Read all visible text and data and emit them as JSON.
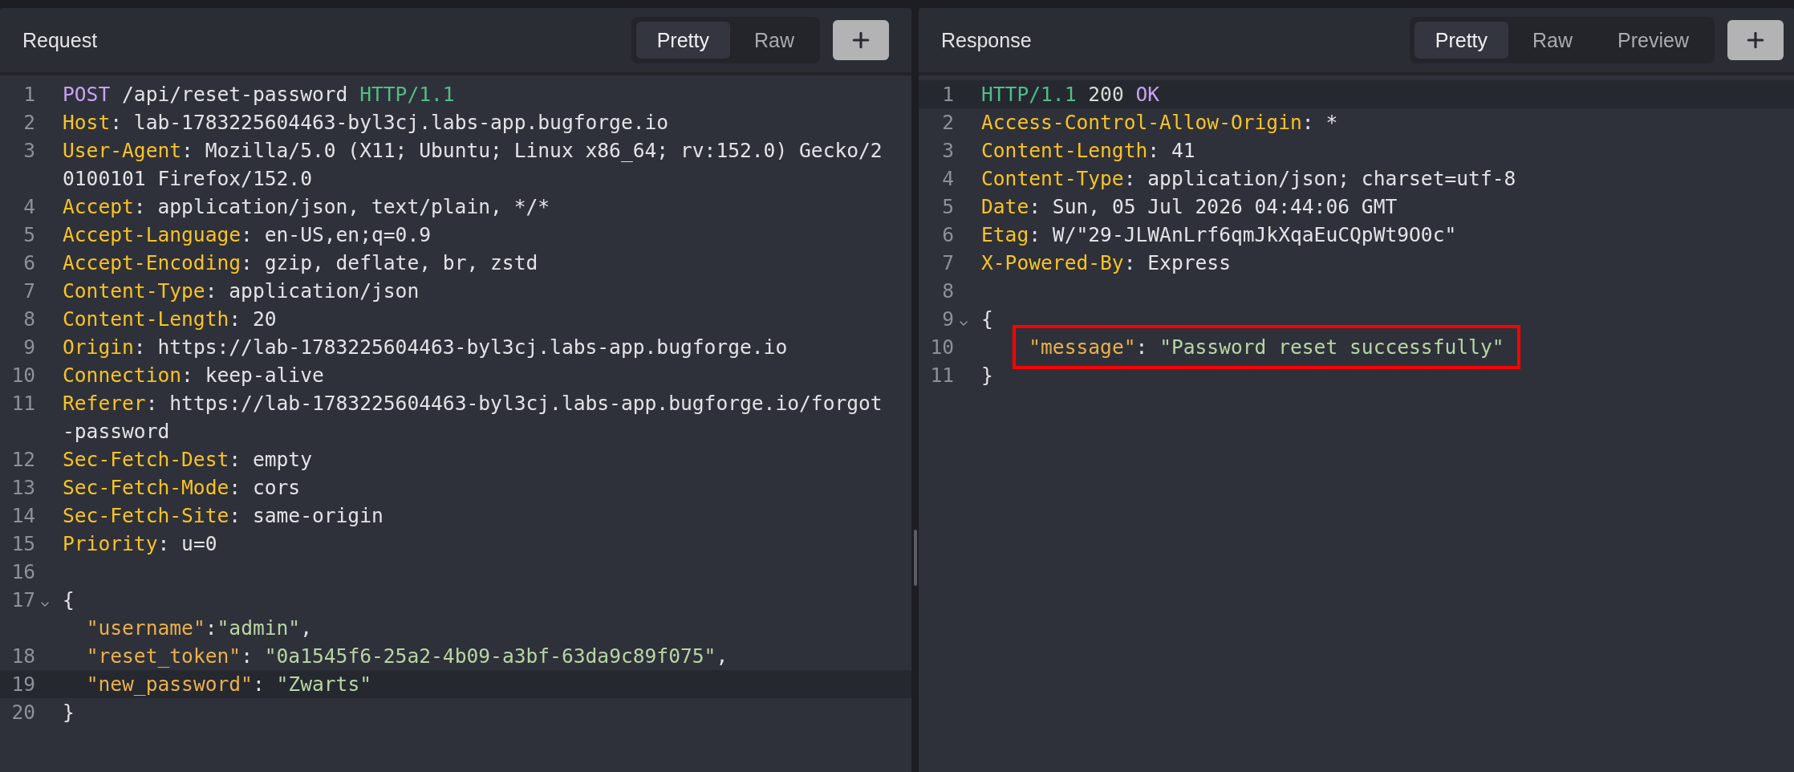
{
  "panels": [
    {
      "title": "Request",
      "tabs": [
        {
          "label": "Pretty",
          "selected": true
        },
        {
          "label": "Raw",
          "selected": false
        }
      ],
      "lines": [
        {
          "number": "1",
          "selected": false,
          "collapsible": false,
          "boxed": false,
          "rows": [
            [
              {
                "kind": "method",
                "text": "POST"
              },
              {
                "kind": "plain",
                "text": " /api/reset-password "
              },
              {
                "kind": "version",
                "text": "HTTP/1.1"
              }
            ]
          ]
        },
        {
          "number": "2",
          "selected": false,
          "collapsible": false,
          "boxed": false,
          "rows": [
            [
              {
                "kind": "key",
                "text": "Host"
              },
              {
                "kind": "plain",
                "text": ": lab-1783225604463-byl3cj.labs-app.bugforge.io"
              }
            ]
          ]
        },
        {
          "number": "3",
          "selected": false,
          "collapsible": false,
          "boxed": false,
          "rows": [
            [
              {
                "kind": "key",
                "text": "User-Agent"
              },
              {
                "kind": "plain",
                "text": ": Mozilla/5.0 (X11; Ubuntu; Linux x86_64; rv:152.0) Gecko/2"
              }
            ],
            [
              {
                "kind": "plain",
                "text": "0100101 Firefox/152.0"
              }
            ]
          ]
        },
        {
          "number": "4",
          "selected": false,
          "collapsible": false,
          "boxed": false,
          "rows": [
            [
              {
                "kind": "key",
                "text": "Accept"
              },
              {
                "kind": "plain",
                "text": ": application/json, text/plain, */*"
              }
            ]
          ]
        },
        {
          "number": "5",
          "selected": false,
          "collapsible": false,
          "boxed": false,
          "rows": [
            [
              {
                "kind": "key",
                "text": "Accept-Language"
              },
              {
                "kind": "plain",
                "text": ": en-US,en;q=0.9"
              }
            ]
          ]
        },
        {
          "number": "6",
          "selected": false,
          "collapsible": false,
          "boxed": false,
          "rows": [
            [
              {
                "kind": "key",
                "text": "Accept-Encoding"
              },
              {
                "kind": "plain",
                "text": ": gzip, deflate, br, zstd"
              }
            ]
          ]
        },
        {
          "number": "7",
          "selected": false,
          "collapsible": false,
          "boxed": false,
          "rows": [
            [
              {
                "kind": "key",
                "text": "Content-Type"
              },
              {
                "kind": "plain",
                "text": ": application/json"
              }
            ]
          ]
        },
        {
          "number": "8",
          "selected": false,
          "collapsible": false,
          "boxed": false,
          "rows": [
            [
              {
                "kind": "key",
                "text": "Content-Length"
              },
              {
                "kind": "plain",
                "text": ": 20"
              }
            ]
          ]
        },
        {
          "number": "9",
          "selected": false,
          "collapsible": false,
          "boxed": false,
          "rows": [
            [
              {
                "kind": "key",
                "text": "Origin"
              },
              {
                "kind": "plain",
                "text": ": https://lab-1783225604463-byl3cj.labs-app.bugforge.io"
              }
            ]
          ]
        },
        {
          "number": "10",
          "selected": false,
          "collapsible": false,
          "boxed": false,
          "rows": [
            [
              {
                "kind": "key",
                "text": "Connection"
              },
              {
                "kind": "plain",
                "text": ": keep-alive"
              }
            ]
          ]
        },
        {
          "number": "11",
          "selected": false,
          "collapsible": false,
          "boxed": false,
          "rows": [
            [
              {
                "kind": "key",
                "text": "Referer"
              },
              {
                "kind": "plain",
                "text": ": https://lab-1783225604463-byl3cj.labs-app.bugforge.io/forgot"
              }
            ],
            [
              {
                "kind": "plain",
                "text": "-password"
              }
            ]
          ]
        },
        {
          "number": "12",
          "selected": false,
          "collapsible": false,
          "boxed": false,
          "rows": [
            [
              {
                "kind": "key",
                "text": "Sec-Fetch-Dest"
              },
              {
                "kind": "plain",
                "text": ": empty"
              }
            ]
          ]
        },
        {
          "number": "13",
          "selected": false,
          "collapsible": false,
          "boxed": false,
          "rows": [
            [
              {
                "kind": "key",
                "text": "Sec-Fetch-Mode"
              },
              {
                "kind": "plain",
                "text": ": cors"
              }
            ]
          ]
        },
        {
          "number": "14",
          "selected": false,
          "collapsible": false,
          "boxed": false,
          "rows": [
            [
              {
                "kind": "key",
                "text": "Sec-Fetch-Site"
              },
              {
                "kind": "plain",
                "text": ": same-origin"
              }
            ]
          ]
        },
        {
          "number": "15",
          "selected": false,
          "collapsible": false,
          "boxed": false,
          "rows": [
            [
              {
                "kind": "key",
                "text": "Priority"
              },
              {
                "kind": "plain",
                "text": ": u=0"
              }
            ]
          ]
        },
        {
          "number": "16",
          "selected": false,
          "collapsible": false,
          "boxed": false
        },
        {
          "number": "17",
          "selected": false,
          "collapsible": true,
          "boxed": false,
          "rows": [
            [
              {
                "kind": "plain",
                "text": "{"
              }
            ],
            [
              {
                "kind": "indent",
                "text": "  "
              },
              {
                "kind": "jkey",
                "text": "\"username\""
              },
              {
                "kind": "plain",
                "text": ":"
              },
              {
                "kind": "string",
                "text": "\"admin\""
              },
              {
                "kind": "plain",
                "text": ","
              }
            ]
          ]
        },
        {
          "number": "18",
          "selected": false,
          "collapsible": false,
          "boxed": false,
          "rows": [
            [
              {
                "kind": "indent",
                "text": "  "
              },
              {
                "kind": "jkey",
                "text": "\"reset_token\""
              },
              {
                "kind": "plain",
                "text": ": "
              },
              {
                "kind": "string",
                "text": "\"0a1545f6-25a2-4b09-a3bf-63da9c89f075\""
              },
              {
                "kind": "plain",
                "text": ","
              }
            ]
          ]
        },
        {
          "number": "19",
          "selected": true,
          "collapsible": false,
          "boxed": false,
          "rows": [
            [
              {
                "kind": "indent",
                "text": "  "
              },
              {
                "kind": "jkey",
                "text": "\"new_password\""
              },
              {
                "kind": "plain",
                "text": ": "
              },
              {
                "kind": "string",
                "text": "\"Zwarts\""
              }
            ]
          ]
        },
        {
          "number": "20",
          "selected": false,
          "collapsible": false,
          "boxed": false,
          "rows": [
            [
              {
                "kind": "plain",
                "text": "}"
              }
            ]
          ]
        }
      ]
    },
    {
      "title": "Response",
      "tabs": [
        {
          "label": "Pretty",
          "selected": true
        },
        {
          "label": "Raw",
          "selected": false
        },
        {
          "label": "Preview",
          "selected": false
        }
      ],
      "lines": [
        {
          "number": "1",
          "selected": true,
          "collapsible": false,
          "boxed": false,
          "rows": [
            [
              {
                "kind": "version",
                "text": "HTTP/1.1"
              },
              {
                "kind": "status",
                "text": " 200 "
              },
              {
                "kind": "method",
                "text": "OK"
              }
            ]
          ]
        },
        {
          "number": "2",
          "selected": false,
          "collapsible": false,
          "boxed": false,
          "rows": [
            [
              {
                "kind": "key",
                "text": "Access-Control-Allow-Origin"
              },
              {
                "kind": "plain",
                "text": ": *"
              }
            ]
          ]
        },
        {
          "number": "3",
          "selected": false,
          "collapsible": false,
          "boxed": false,
          "rows": [
            [
              {
                "kind": "key",
                "text": "Content-Length"
              },
              {
                "kind": "plain",
                "text": ": 41"
              }
            ]
          ]
        },
        {
          "number": "4",
          "selected": false,
          "collapsible": false,
          "boxed": false,
          "rows": [
            [
              {
                "kind": "key",
                "text": "Content-Type"
              },
              {
                "kind": "plain",
                "text": ": application/json; charset=utf-8"
              }
            ]
          ]
        },
        {
          "number": "5",
          "selected": false,
          "collapsible": false,
          "boxed": false,
          "rows": [
            [
              {
                "kind": "key",
                "text": "Date"
              },
              {
                "kind": "plain",
                "text": ": Sun, 05 Jul 2026 04:44:06 GMT"
              }
            ]
          ]
        },
        {
          "number": "6",
          "selected": false,
          "collapsible": false,
          "boxed": false,
          "rows": [
            [
              {
                "kind": "key",
                "text": "Etag"
              },
              {
                "kind": "plain",
                "text": ": W/\"29-JLWAnLrf6qmJkXqaEuCQpWt9O0c\""
              }
            ]
          ]
        },
        {
          "number": "7",
          "selected": false,
          "collapsible": false,
          "boxed": false,
          "rows": [
            [
              {
                "kind": "key",
                "text": "X-Powered-By"
              },
              {
                "kind": "plain",
                "text": ": Express"
              }
            ]
          ]
        },
        {
          "number": "8",
          "selected": false,
          "collapsible": false,
          "boxed": false
        },
        {
          "number": "9",
          "selected": false,
          "collapsible": true,
          "boxed": false,
          "rows": [
            [
              {
                "kind": "plain",
                "text": "{"
              }
            ]
          ]
        },
        {
          "number": "10",
          "selected": false,
          "collapsible": false,
          "boxed": true,
          "rows": [
            [
              {
                "kind": "indent",
                "text": "    "
              },
              {
                "kind": "jkey",
                "text": "\"message\""
              },
              {
                "kind": "plain",
                "text": ": "
              },
              {
                "kind": "string",
                "text": "\"Password reset successfully\""
              }
            ]
          ]
        },
        {
          "number": "11",
          "selected": false,
          "collapsible": false,
          "boxed": false,
          "rows": [
            [
              {
                "kind": "plain",
                "text": "}"
              }
            ]
          ]
        }
      ]
    }
  ]
}
